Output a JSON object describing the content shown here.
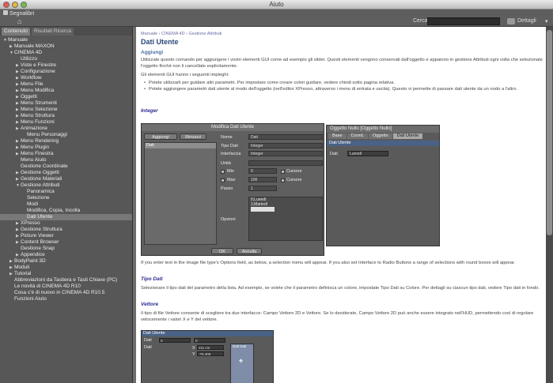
{
  "window": {
    "title": "Aiuto"
  },
  "toolbar": {
    "bookmarks_label": "Segnalibri",
    "search_label": "Cerca",
    "search_value": "",
    "details_label": "Dettagli"
  },
  "sidebar": {
    "tabs": [
      {
        "label": "Contenuto",
        "active": true
      },
      {
        "label": "Risultati Ricerca",
        "active": false
      }
    ],
    "tree": [
      {
        "indent": 0,
        "expander": "▼",
        "label": "Manuale"
      },
      {
        "indent": 1,
        "expander": "▶",
        "label": "Manuale MAXON"
      },
      {
        "indent": 1,
        "expander": "▼",
        "label": "CINEMA 4D"
      },
      {
        "indent": 2,
        "expander": "",
        "label": "Utilizzo"
      },
      {
        "indent": 2,
        "expander": "▶",
        "label": "Viste e Finestre"
      },
      {
        "indent": 2,
        "expander": "▶",
        "label": "Configurazione"
      },
      {
        "indent": 2,
        "expander": "▶",
        "label": "Workflow"
      },
      {
        "indent": 2,
        "expander": "▶",
        "label": "Menu File"
      },
      {
        "indent": 2,
        "expander": "▶",
        "label": "Menu Modifica"
      },
      {
        "indent": 2,
        "expander": "▶",
        "label": "Oggetti"
      },
      {
        "indent": 2,
        "expander": "▶",
        "label": "Menu Strumenti"
      },
      {
        "indent": 2,
        "expander": "▶",
        "label": "Menu Selezione"
      },
      {
        "indent": 2,
        "expander": "▶",
        "label": "Menu Struttura"
      },
      {
        "indent": 2,
        "expander": "▶",
        "label": "Menu Funzioni"
      },
      {
        "indent": 2,
        "expander": "▶",
        "label": "Animazione"
      },
      {
        "indent": 3,
        "expander": "",
        "label": "Menu Personaggi"
      },
      {
        "indent": 2,
        "expander": "▶",
        "label": "Menu Rendering"
      },
      {
        "indent": 2,
        "expander": "▶",
        "label": "Menu Plugin"
      },
      {
        "indent": 2,
        "expander": "▶",
        "label": "Menu Finestra"
      },
      {
        "indent": 2,
        "expander": "",
        "label": "Menu Aiuto"
      },
      {
        "indent": 2,
        "expander": "",
        "label": "Gestione Coordinate"
      },
      {
        "indent": 2,
        "expander": "▶",
        "label": "Gestione Oggetti"
      },
      {
        "indent": 2,
        "expander": "▶",
        "label": "Gestione Materiali"
      },
      {
        "indent": 2,
        "expander": "▼",
        "label": "Gestione Attributi"
      },
      {
        "indent": 3,
        "expander": "",
        "label": "Panoramica"
      },
      {
        "indent": 3,
        "expander": "",
        "label": "Selezione"
      },
      {
        "indent": 3,
        "expander": "",
        "label": "Modi"
      },
      {
        "indent": 3,
        "expander": "",
        "label": "Modifica, Copia, Incolla"
      },
      {
        "indent": 3,
        "expander": "",
        "label": "Dati Utente",
        "selected": true
      },
      {
        "indent": 2,
        "expander": "▶",
        "label": "XPresso"
      },
      {
        "indent": 2,
        "expander": "▶",
        "label": "Gestione Struttura"
      },
      {
        "indent": 2,
        "expander": "▶",
        "label": "Picture Viewer"
      },
      {
        "indent": 2,
        "expander": "▶",
        "label": "Content Browser"
      },
      {
        "indent": 2,
        "expander": "",
        "label": "Gestione Snap"
      },
      {
        "indent": 2,
        "expander": "▶",
        "label": "Appendice"
      },
      {
        "indent": 1,
        "expander": "▶",
        "label": "BodyPaint 3D"
      },
      {
        "indent": 1,
        "expander": "▶",
        "label": "Moduli"
      },
      {
        "indent": 1,
        "expander": "▶",
        "label": "Tutorial"
      },
      {
        "indent": 1,
        "expander": "",
        "label": "Abbreviazioni da Tastiera e Tasti Chiave (PC)"
      },
      {
        "indent": 1,
        "expander": "",
        "label": "Le novità di CINEMA 4D R10"
      },
      {
        "indent": 1,
        "expander": "",
        "label": "Cosa c'è di nuovo in CINEMA 4D R10.5"
      },
      {
        "indent": 1,
        "expander": "",
        "label": "Funzioni Aiuto"
      }
    ]
  },
  "content": {
    "breadcrumb": "Manuale › CINEMA 4D › Gestione Attributi",
    "title": "Dati Utente",
    "section_add": "Aggiungi",
    "intro": "Utilizzate questo comando per aggiungere i vostri elementi GUI come ad esempio gli slider. Questi elementi vengono conservati dall'oggetto e appaiono in gestione Attributi ogni volta che selezionate l'oggetto finché non li cancellate esplicitamente.",
    "gui_intro": "Gli elementi GUI hanno i seguenti impieghi:",
    "bullets": [
      "Potete utilizzarli per guidare altri parametri. Per impostare come creare colori guidare, vedere chiodi sotto pagina relativa.",
      "Potete aggiungere parametri dati utente al modo dell'oggetto (nell'editor XPresso, attraverso i menu di entrata e uscita). Questo vi permette di passare dati utente da un nodo a l'altro."
    ],
    "section_integer": "Integer",
    "dialog": {
      "title": "Modifica Dati Utente",
      "add_button": "Aggiungi",
      "remove_button": "Rimuovi",
      "list_item": "Dati",
      "fields": [
        {
          "label": "Nome",
          "value": "Dati"
        },
        {
          "label": "Tipo Dati",
          "value": "Integer"
        },
        {
          "label": "Interfaccia",
          "value": "Integer"
        },
        {
          "label": "Unità",
          "value": ""
        },
        {
          "label": "Min",
          "value": "0"
        },
        {
          "label": "Max",
          "value": "100"
        },
        {
          "label": "Passo",
          "value": "1"
        }
      ],
      "cursor_label": "Cursore",
      "options_label": "Opzioni",
      "options": [
        "0;Lunedì",
        "1;Martedì",
        ""
      ],
      "ok_button": "OK",
      "cancel_button": "Annulla"
    },
    "object_panel": {
      "title": "Oggetto Nullo [Oggetto Nullo]",
      "tabs": [
        "Base",
        "Coord.",
        "Oggetto",
        "Dati Utente"
      ],
      "active_tab": 3,
      "section": "Dati Utente",
      "row_label": "Dati",
      "row_value": "Lunedì"
    },
    "interface_note": "If you enter text in the image file type's Options field, as below, a selection menu will appear. If you also set Interface to Radio Buttons a range of selections with round boxes will appear.",
    "section_tipo": "Tipo Dati",
    "tipo_text": "Selezionare il tipo dati del parametro della lista. Ad esempio, se volete che il parametro definisca un colore, impostate Tipo Dati su Colore. Per dettagli su ciascun tipo dati, vedere Tipo dati in fondo.",
    "section_vector": "Vettore",
    "vector_text": "Il tipo di file Vettore consente di scegliere tra due interfacce: Campo Vettore 2D e Vettore. Se lo desiderate, Campo Vettore 2D può anche essere integrato nell'HUD, permettendo così di regolare velocemente i valori X e Y del vettore.",
    "mini": {
      "section": "Dati Utente",
      "row1_label": "Dati",
      "row1_value": "0",
      "row1_value2": "0",
      "row2_label": "Dati",
      "x_label": "X",
      "x_value": "211 cm",
      "y_label": "Y",
      "y_value": "-76.405",
      "panel_title": "Dati Dati"
    }
  }
}
